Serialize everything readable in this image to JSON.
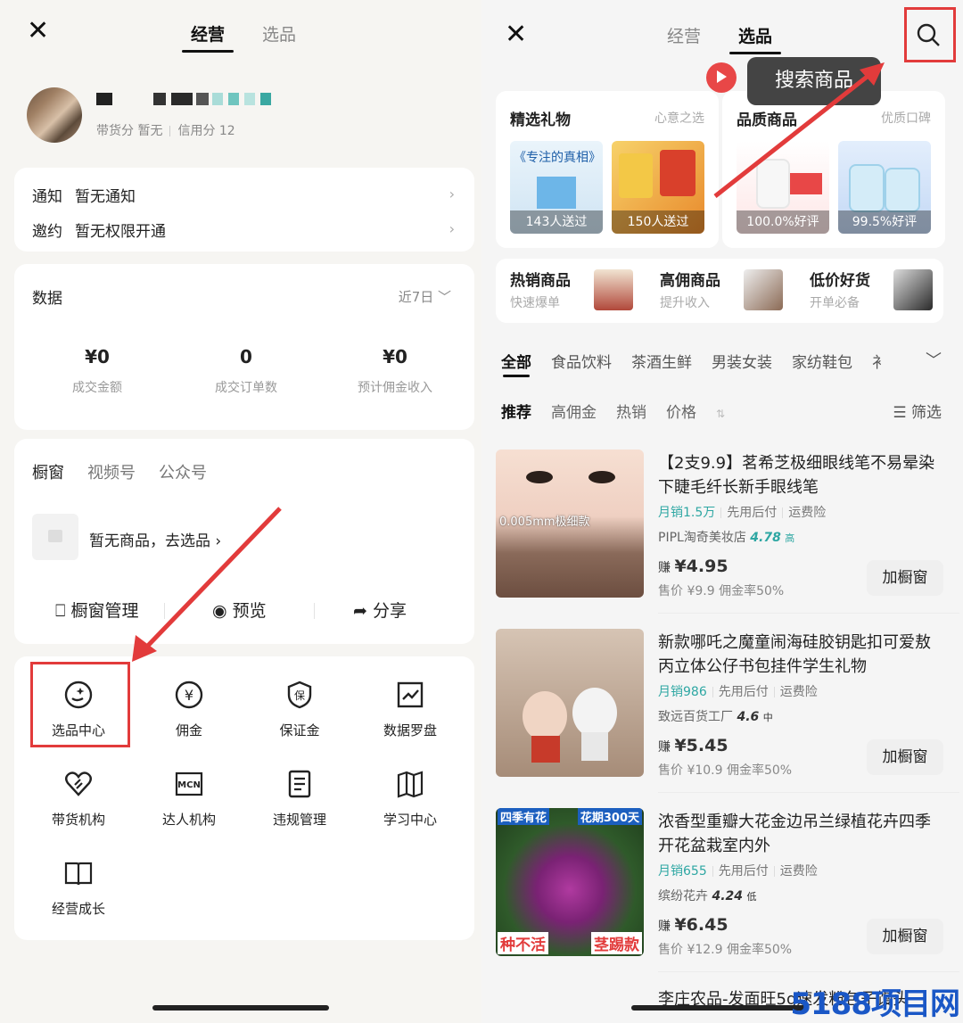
{
  "left": {
    "close_icon": "✕",
    "tabs": [
      "经营",
      "选品"
    ],
    "profile": {
      "meta_goods_score": "带货分 暂无",
      "meta_credit": "信用分 12"
    },
    "notices": [
      {
        "label": "通知",
        "value": "暂无通知"
      },
      {
        "label": "邀约",
        "value": "暂无权限开通"
      }
    ],
    "data_section": {
      "title": "数据",
      "period": "近7日 ﹀",
      "stats": [
        {
          "value": "¥0",
          "label": "成交金额"
        },
        {
          "value": "0",
          "label": "成交订单数"
        },
        {
          "value": "¥0",
          "label": "预计佣金收入"
        }
      ]
    },
    "window_section": {
      "tabs": [
        "橱窗",
        "视频号",
        "公众号"
      ],
      "empty_text": "暂无商品，去选品 ›",
      "actions": [
        "橱窗管理",
        "预览",
        "分享"
      ]
    },
    "tools": [
      {
        "label": "选品中心",
        "icon": "product-selection-icon"
      },
      {
        "label": "佣金",
        "icon": "yen-coin-icon"
      },
      {
        "label": "保证金",
        "icon": "shield-deposit-icon"
      },
      {
        "label": "数据罗盘",
        "icon": "trend-chart-icon"
      },
      {
        "label": "带货机构",
        "icon": "heart-org-icon"
      },
      {
        "label": "达人机构",
        "icon": "mcn-icon"
      },
      {
        "label": "违规管理",
        "icon": "document-icon"
      },
      {
        "label": "学习中心",
        "icon": "book-open-icon"
      },
      {
        "label": "经营成长",
        "icon": "book-icon"
      }
    ]
  },
  "right": {
    "close_icon": "✕",
    "tabs": [
      "经营",
      "选品"
    ],
    "tooltip": "搜索商品",
    "featured": [
      {
        "title": "精选礼物",
        "subtitle": "心意之选",
        "items": [
          {
            "caption": "143人送过"
          },
          {
            "caption": "150人送过"
          }
        ]
      },
      {
        "title": "品质商品",
        "subtitle": "优质口碑",
        "items": [
          {
            "caption": "100.0%好评"
          },
          {
            "caption": "99.5%好评"
          }
        ]
      }
    ],
    "gift_book_text": "《专注的真相》",
    "quick_entries": [
      {
        "title": "热销商品",
        "subtitle": "快速爆单"
      },
      {
        "title": "高佣商品",
        "subtitle": "提升收入"
      },
      {
        "title": "低价好货",
        "subtitle": "开单必备"
      }
    ],
    "categories": [
      "全部",
      "食品饮料",
      "茶酒生鲜",
      "男装女装",
      "家纺鞋包",
      "衤"
    ],
    "sort_options": [
      "推荐",
      "高佣金",
      "热销",
      "价格"
    ],
    "price_sort_icon": "⇅",
    "filter_label": "筛选",
    "products": [
      {
        "title": "【2支9.9】茗希芝极细眼线笔不易晕染下睫毛纤长新手眼线笔",
        "monthly_sales": "月销1.5万",
        "pay_later": "先用后付",
        "insurance": "运费险",
        "shop": "PIPL淘奇美妆店",
        "score": "4.78",
        "score_level": "高",
        "earn_prefix": "赚",
        "earn": "¥4.95",
        "price_line": "售价 ¥9.9  佣金率50%",
        "button": "加橱窗",
        "image_caption": "0.005mm极细款"
      },
      {
        "title": "新款哪吒之魔童闹海硅胶钥匙扣可爱敖丙立体公仔书包挂件学生礼物",
        "monthly_sales": "月销986",
        "pay_later": "先用后付",
        "insurance": "运费险",
        "shop": "致远百货工厂",
        "score": "4.6",
        "score_level": "中",
        "earn_prefix": "赚",
        "earn": "¥5.45",
        "price_line": "售价 ¥10.9  佣金率50%",
        "button": "加橱窗"
      },
      {
        "title": "浓香型重瓣大花金边吊兰绿植花卉四季开花盆栽室内外",
        "monthly_sales": "月销655",
        "pay_later": "先用后付",
        "insurance": "运费险",
        "shop": "缤纷花卉",
        "score": "4.24",
        "score_level": "低",
        "earn_prefix": "赚",
        "earn": "¥6.45",
        "price_line": "售价 ¥12.9  佣金率50%",
        "button": "加橱窗",
        "image_caption_top_left": "四季有花",
        "image_caption_top_right": "花期300天",
        "image_caption_bottom_left": "种不活",
        "image_caption_bottom_right": "茎踢款"
      }
    ],
    "partial_next_title": "李庄农品-发面旺5g速发粉包子馒头"
  },
  "watermark": "5188项目网",
  "colors": {
    "annotation_red": "#e23b3b",
    "teal": "#2ea7a3",
    "watermark_blue": "#1a57c6"
  }
}
